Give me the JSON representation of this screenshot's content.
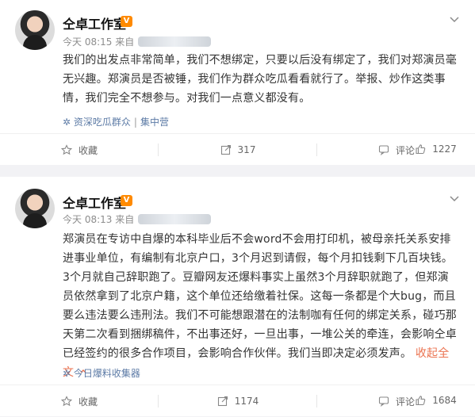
{
  "posts": [
    {
      "author": "仝卓工作室",
      "vip_badge": "V",
      "time_prefix": "今天 08:15 来自",
      "content": "我们的出发点非常简单，我们不想绑定，只要以后没有绑定了，我们对郑演员毫无兴趣。郑演员是否被锤，我们作为群众吃瓜看看就行了。举报、炒作这类事情，我们完全不想参与。对我们一点意义都没有。",
      "source": "资深吃瓜群众",
      "source_extra": "集中营",
      "actions": {
        "favorite": "收藏",
        "forward": "317",
        "comment": "评论",
        "like": "1227"
      }
    },
    {
      "author": "仝卓工作室",
      "vip_badge": "V",
      "time_prefix": "今天 08:13 来自",
      "content": "郑演员在专访中自爆的本科毕业后不会word不会用打印机，被母亲托关系安排进事业单位，有编制有北京户口，3个月迟到请假，每个月扣钱剩下几百块钱。3个月就自己辞职跑了。豆瓣网友还爆料事实上虽然3个月辞职就跑了，但郑演员依然拿到了北京户籍，这个单位还给缴着社保。这每一条都是个大bug，而且要么违法要么违刑法。我们不可能想跟潜在的法制咖有任何的绑定关系，碰巧那天第二次看到捆绑稿件，不出事还好，一旦出事，一堆公关的牵连，会影响仝卓已经签约的很多合作项目，会影响合作伙伴。我们当即决定必须发声。",
      "collapse": "收起全文",
      "source": "今日爆料收集器",
      "actions": {
        "favorite": "收藏",
        "forward": "1174",
        "comment": "评论",
        "like": "1684"
      }
    }
  ],
  "colors": {
    "background": "#f2f2f5",
    "card": "#ffffff",
    "accent": "#eb7350",
    "link": "#5d7ba6"
  },
  "icons": [
    "avatar",
    "vip-badge-icon",
    "chevron-down-icon",
    "favorite-icon",
    "forward-icon",
    "comment-icon",
    "like-icon",
    "source-icon"
  ]
}
